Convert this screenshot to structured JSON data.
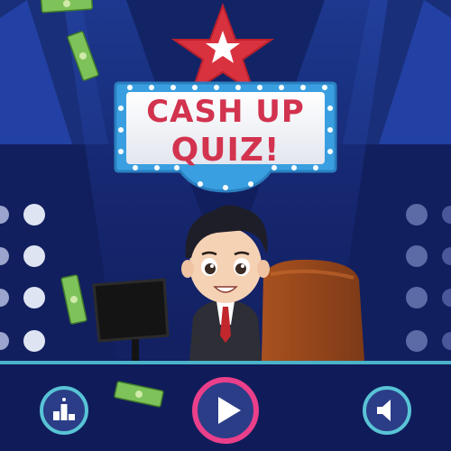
{
  "game": {
    "title_line1": "CASH UP",
    "title_line2": "QUIZ!"
  },
  "buttons": {
    "leaderboard_icon": "podium-icon",
    "play_icon": "play-icon",
    "sound_icon": "speaker-icon"
  },
  "colors": {
    "background": "#0f1e5c",
    "title_text": "#d2334e",
    "play_ring": "#ea3f8a",
    "button_ring": "#58c4d6",
    "star": "#d9323f"
  }
}
